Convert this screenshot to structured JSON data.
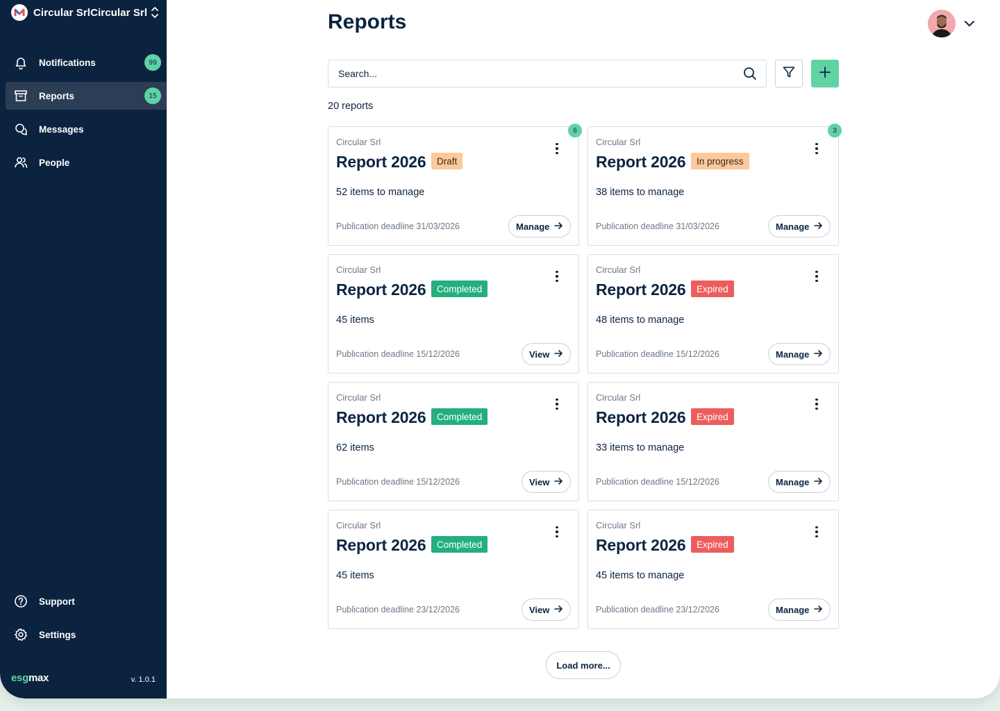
{
  "org": {
    "name": "Circular SrlCircular Srl"
  },
  "nav": {
    "notifications": {
      "label": "Notifications",
      "badge": "99"
    },
    "reports": {
      "label": "Reports",
      "badge": "15"
    },
    "messages": {
      "label": "Messages"
    },
    "people": {
      "label": "People"
    },
    "support": {
      "label": "Support"
    },
    "settings": {
      "label": "Settings"
    }
  },
  "brand": {
    "esg": "esg",
    "max": "max",
    "version": "v. 1.0.1"
  },
  "header": {
    "title": "Reports"
  },
  "search": {
    "placeholder": "Search..."
  },
  "summary": {
    "count_text": "20 reports"
  },
  "colors": {
    "sidebar": "#0c2340",
    "accent": "#5fd3a3",
    "draft": "#fbc99b",
    "completed": "#23b07c",
    "expired": "#ee5d5d"
  },
  "cards": [
    {
      "company": "Circular Srl",
      "title": "Report 2026",
      "status": "Draft",
      "items": "52 items to manage",
      "deadline": "Publication deadline 31/03/2026",
      "action": "Manage",
      "badge": "6"
    },
    {
      "company": "Circular Srl",
      "title": "Report 2026",
      "status": "In progress",
      "items": "38 items to manage",
      "deadline": "Publication deadline 31/03/2026",
      "action": "Manage",
      "badge": "3"
    },
    {
      "company": "Circular Srl",
      "title": "Report 2026",
      "status": "Completed",
      "items": "45 items",
      "deadline": "Publication deadline 15/12/2026",
      "action": "View"
    },
    {
      "company": "Circular Srl",
      "title": "Report 2026",
      "status": "Expired",
      "items": "48 items to manage",
      "deadline": "Publication deadline 15/12/2026",
      "action": "Manage"
    },
    {
      "company": "Circular Srl",
      "title": "Report 2026",
      "status": "Completed",
      "items": "62 items",
      "deadline": "Publication deadline 15/12/2026",
      "action": "View"
    },
    {
      "company": "Circular Srl",
      "title": "Report 2026",
      "status": "Expired",
      "items": "33 items to manage",
      "deadline": "Publication deadline 15/12/2026",
      "action": "Manage"
    },
    {
      "company": "Circular Srl",
      "title": "Report 2026",
      "status": "Completed",
      "items": "45 items",
      "deadline": "Publication deadline 23/12/2026",
      "action": "View"
    },
    {
      "company": "Circular Srl",
      "title": "Report 2026",
      "status": "Expired",
      "items": "45 items to manage",
      "deadline": "Publication deadline 23/12/2026",
      "action": "Manage"
    }
  ],
  "load_more": "Load more..."
}
